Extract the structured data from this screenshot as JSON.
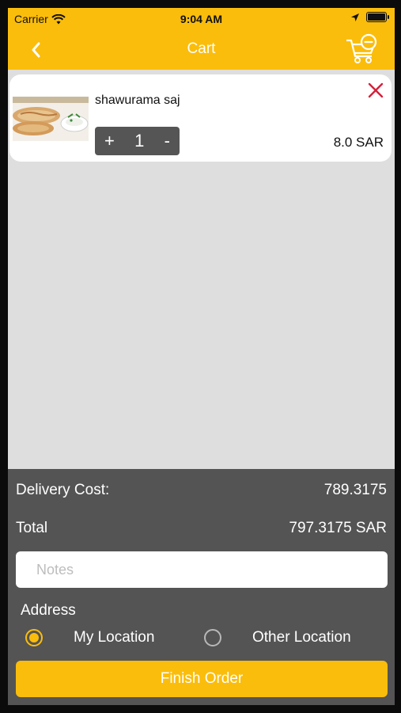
{
  "status_bar": {
    "carrier": "Carrier",
    "time": "9:04 AM",
    "icons": [
      "wifi-icon",
      "location-arrow-icon",
      "battery-icon"
    ]
  },
  "header": {
    "title": "Cart",
    "back_icon": "chevron-left-icon",
    "action_icon": "cart-remove-icon"
  },
  "cart": {
    "items": [
      {
        "name": "shawurama saj",
        "quantity": "1",
        "increment_label": "+",
        "decrement_label": "-",
        "price": "8.0 SAR",
        "remove_icon": "close-icon"
      }
    ]
  },
  "summary": {
    "delivery_label": "Delivery Cost:",
    "delivery_value": "789.3175",
    "total_label": "Total",
    "total_value": "797.3175 SAR"
  },
  "notes": {
    "placeholder": "Notes",
    "value": ""
  },
  "address": {
    "label": "Address",
    "options": [
      {
        "label": "My Location",
        "selected": true
      },
      {
        "label": "Other Location",
        "selected": false
      }
    ]
  },
  "actions": {
    "finish_label": "Finish Order"
  },
  "colors": {
    "accent": "#fbbd0b",
    "panel": "#545454",
    "list_background": "#dedede",
    "remove": "#d6203a"
  }
}
